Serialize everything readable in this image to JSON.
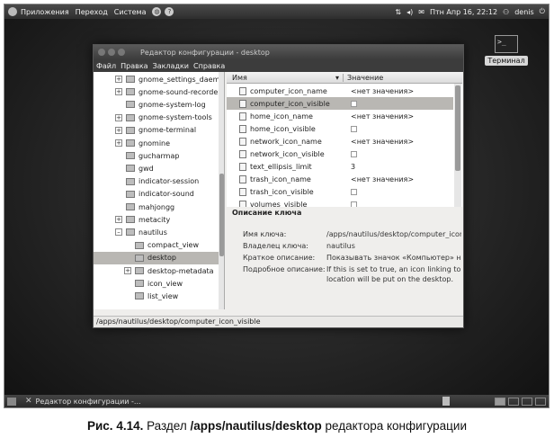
{
  "top_panel": {
    "menus": [
      "Приложения",
      "Переход",
      "Система"
    ],
    "clock": "Птн Апр 16, 22:12",
    "user": "denis"
  },
  "desktop_icon": {
    "label": "Терминал",
    "glyph": ">_"
  },
  "window": {
    "title": "Редактор конфигурации - desktop",
    "menus": [
      "Файл",
      "Правка",
      "Закладки",
      "Справка"
    ]
  },
  "tree": {
    "items": [
      {
        "label": "gnome_settings_daemo",
        "expander": "+",
        "selected": false,
        "indent": 0
      },
      {
        "label": "gnome-sound-recorder",
        "expander": "+",
        "selected": false,
        "indent": 0
      },
      {
        "label": "gnome-system-log",
        "expander": "",
        "selected": false,
        "indent": 0
      },
      {
        "label": "gnome-system-tools",
        "expander": "+",
        "selected": false,
        "indent": 0
      },
      {
        "label": "gnome-terminal",
        "expander": "+",
        "selected": false,
        "indent": 0
      },
      {
        "label": "gnomine",
        "expander": "+",
        "selected": false,
        "indent": 0
      },
      {
        "label": "gucharmap",
        "expander": "",
        "selected": false,
        "indent": 0
      },
      {
        "label": "gwd",
        "expander": "",
        "selected": false,
        "indent": 0
      },
      {
        "label": "indicator-session",
        "expander": "",
        "selected": false,
        "indent": 0
      },
      {
        "label": "indicator-sound",
        "expander": "",
        "selected": false,
        "indent": 0
      },
      {
        "label": "mahjongg",
        "expander": "",
        "selected": false,
        "indent": 0
      },
      {
        "label": "metacity",
        "expander": "+",
        "selected": false,
        "indent": 0
      },
      {
        "label": "nautilus",
        "expander": "–",
        "selected": false,
        "indent": 0
      },
      {
        "label": "compact_view",
        "expander": "",
        "selected": false,
        "indent": 1
      },
      {
        "label": "desktop",
        "expander": "",
        "selected": true,
        "indent": 1
      },
      {
        "label": "desktop-metadata",
        "expander": "+",
        "selected": false,
        "indent": 1
      },
      {
        "label": "icon_view",
        "expander": "",
        "selected": false,
        "indent": 1
      },
      {
        "label": "list_view",
        "expander": "",
        "selected": false,
        "indent": 1
      }
    ]
  },
  "keys": {
    "col_name": "Имя",
    "col_value": "Значение",
    "rows": [
      {
        "name": "computer_icon_name",
        "value": "<нет значения>",
        "type": "text",
        "selected": false
      },
      {
        "name": "computer_icon_visible",
        "value": "",
        "type": "bool",
        "selected": true
      },
      {
        "name": "home_icon_name",
        "value": "<нет значения>",
        "type": "text",
        "selected": false
      },
      {
        "name": "home_icon_visible",
        "value": "",
        "type": "bool",
        "selected": false
      },
      {
        "name": "network_icon_name",
        "value": "<нет значения>",
        "type": "text",
        "selected": false
      },
      {
        "name": "network_icon_visible",
        "value": "",
        "type": "bool",
        "selected": false
      },
      {
        "name": "text_ellipsis_limit",
        "value": "3",
        "type": "text",
        "selected": false
      },
      {
        "name": "trash_icon_name",
        "value": "<нет значения>",
        "type": "text",
        "selected": false
      },
      {
        "name": "trash_icon_visible",
        "value": "",
        "type": "bool",
        "selected": false
      },
      {
        "name": "volumes_visible",
        "value": "",
        "type": "bool",
        "selected": false
      }
    ]
  },
  "details": {
    "title": "Описание ключа",
    "rows": [
      {
        "label": "Имя ключа:",
        "value": "/apps/nautilus/desktop/computer_icon_v"
      },
      {
        "label": "Владелец ключа:",
        "value": "nautilus"
      },
      {
        "label": "Краткое описание:",
        "value": "Показывать значок «Компьютер» на р"
      },
      {
        "label": "Подробное описание:",
        "value": "If this is set to true, an icon linking to th"
      },
      {
        "label": "",
        "value": "location will be put on the desktop."
      }
    ]
  },
  "statusbar": "/apps/nautilus/desktop/computer_icon_visible",
  "bottom_panel": {
    "task": "Редактор конфигурации -..."
  },
  "caption": {
    "prefix": "Рис. 4.14.",
    "mid": " Раздел ",
    "path": "/apps/nautilus/desktop",
    "suffix": " редактора конфигурации"
  }
}
